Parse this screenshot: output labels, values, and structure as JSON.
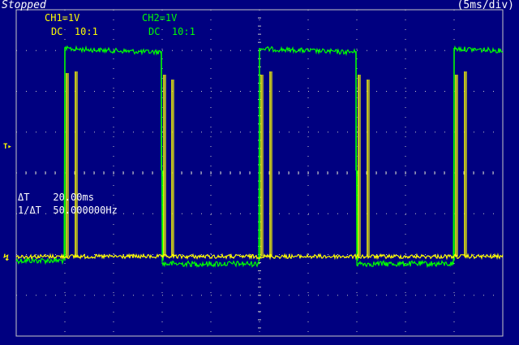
{
  "status": {
    "state": "Stopped",
    "timebase": "(5ms/div)"
  },
  "channels": {
    "ch1": {
      "scale": "CH1=1V",
      "coupling": "DC  10:1",
      "color": "#ffff00"
    },
    "ch2": {
      "scale": "CH2=1V",
      "coupling": "DC  10:1",
      "color": "#00ff00"
    }
  },
  "measurements": {
    "delta_t": "ΔT    20.00ms",
    "inv_delta_t": "1/ΔT  50.000000Hz"
  },
  "markers": {
    "trigger": "T▸",
    "ground": "↯"
  },
  "colors": {
    "background": "#000080",
    "grid": "#c8c8c8",
    "ch1": "#ffff00",
    "ch2": "#00ff00"
  }
}
